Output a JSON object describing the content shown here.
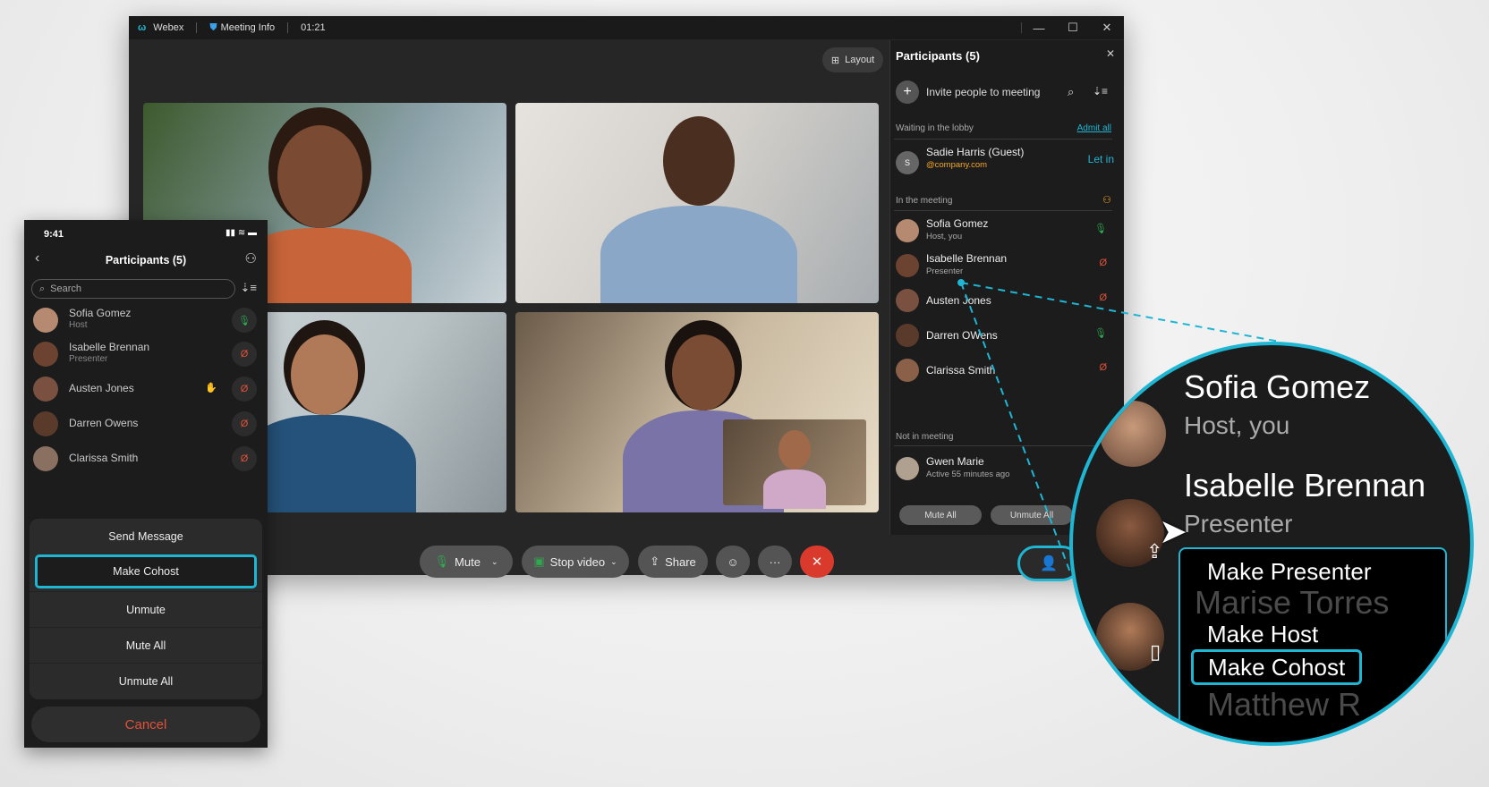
{
  "colors": {
    "accent": "#1fb6d4",
    "leave": "#d93a2b",
    "mic_on": "#2fa84f",
    "mic_off": "#e0523a",
    "orange": "#f5a623"
  },
  "titlebar": {
    "app": "Webex",
    "meeting_info": "Meeting Info",
    "timer": "01:21"
  },
  "layout_button": "Layout",
  "controls": {
    "mute": "Mute",
    "stop_video": "Stop video",
    "share": "Share",
    "more": "···",
    "leave": "✕"
  },
  "panel": {
    "title": "Participants (5)",
    "invite": "Invite people to meeting",
    "lobby_label": "Waiting in the lobby",
    "admit_all": "Admit all",
    "lobby": [
      {
        "name": "Sadie Harris (Guest)",
        "sub": "@company.com",
        "initial": "S",
        "action": "Let in"
      }
    ],
    "in_meeting_label": "In the meeting",
    "participants": [
      {
        "name": "Sofia Gomez",
        "sub": "Host, you",
        "mic": "on"
      },
      {
        "name": "Isabelle Brennan",
        "sub": "Presenter",
        "mic": "off"
      },
      {
        "name": "Austen Jones",
        "sub": "",
        "mic": "off"
      },
      {
        "name": "Darren OWens",
        "sub": "",
        "mic": "on"
      },
      {
        "name": "Clarissa Smith",
        "sub": "",
        "mic": "off"
      }
    ],
    "not_in_meeting_label": "Not in meeting",
    "not_in_meeting": [
      {
        "name": "Gwen Marie",
        "sub": "Active 55 minutes ago"
      }
    ],
    "mute_all": "Mute All",
    "unmute_all": "Unmute All"
  },
  "phone": {
    "time": "9:41",
    "title": "Participants (5)",
    "search_placeholder": "Search",
    "participants": [
      {
        "name": "Sofia Gomez",
        "sub": "Host",
        "mic": "on"
      },
      {
        "name": "Isabelle Brennan",
        "sub": "Presenter",
        "mic": "off"
      },
      {
        "name": "Austen Jones",
        "sub": "",
        "mic": "off",
        "hand": true
      },
      {
        "name": "Darren Owens",
        "sub": "",
        "mic": "off"
      },
      {
        "name": "Clarissa Smith",
        "sub": "",
        "mic": "off"
      }
    ],
    "sheet": [
      "Send Message",
      "Make Cohost",
      "Unmute",
      "Mute All",
      "Unmute All"
    ],
    "selected": "Make Cohost",
    "cancel": "Cancel"
  },
  "magnifier": {
    "rows": [
      {
        "name": "Sofia Gomez",
        "sub": "Host, you"
      },
      {
        "name": "Isabelle Brennan",
        "sub": "Presenter"
      }
    ],
    "hidden_name": "Marise Torres",
    "hidden_name2": "Matthew R",
    "menu": [
      "Make Presenter",
      "Make Host",
      "Make Cohost"
    ],
    "selected": "Make Cohost"
  }
}
